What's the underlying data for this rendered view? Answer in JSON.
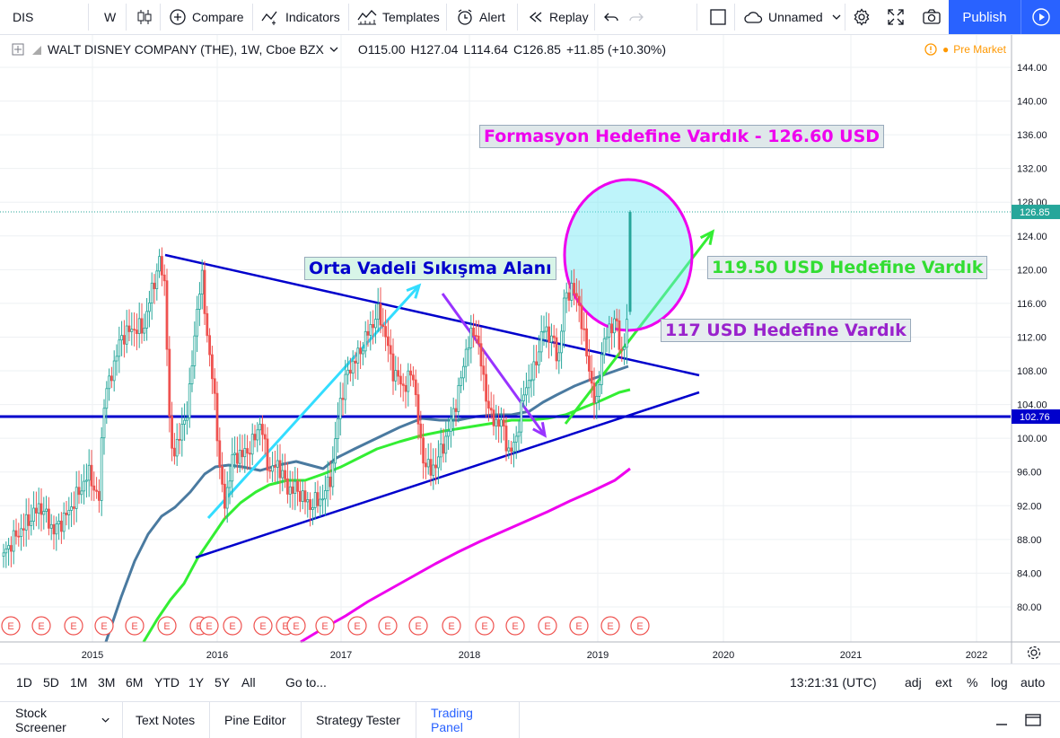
{
  "toolbar": {
    "symbol": "DIS",
    "interval": "W",
    "compare": "Compare",
    "indicators": "Indicators",
    "templates": "Templates",
    "alert": "Alert",
    "replay": "Replay",
    "layout_name": "Unnamed",
    "publish": "Publish"
  },
  "legend": {
    "title": "WALT DISNEY COMPANY (THE), 1W, Cboe BZX",
    "open": "O115.00",
    "high": "H127.04",
    "low": "L114.64",
    "close": "C126.85",
    "change": "+11.85 (+10.30%)",
    "premarket": "Pre Market"
  },
  "price_axis": {
    "ticks": [
      "144.00",
      "140.00",
      "136.00",
      "132.00",
      "128.00",
      "124.00",
      "120.00",
      "116.00",
      "112.00",
      "108.00",
      "104.00",
      "100.00",
      "96.00",
      "92.00",
      "88.00",
      "84.00",
      "80.00"
    ],
    "last_price_label": "126.85",
    "hline_label": "102.76"
  },
  "time_axis": {
    "ticks": [
      "2015",
      "2016",
      "2017",
      "2018",
      "2019",
      "2020",
      "2021",
      "2022"
    ]
  },
  "annotations": {
    "target1": "Formasyon Hedefine Vardık - 126.60 USD",
    "compression": "Orta Vadeli Sıkışma Alanı",
    "target2": "119.50 USD Hedefine Vardık",
    "target3": "117 USD Hedefine Vardık"
  },
  "earnings_marker": "E",
  "ranges": {
    "items": [
      "1D",
      "5D",
      "1M",
      "3M",
      "6M",
      "YTD",
      "1Y",
      "5Y",
      "All"
    ],
    "goto": "Go to...",
    "time": "13:21:31 (UTC)",
    "adj": "adj",
    "ext": "ext",
    "pct": "%",
    "log": "log",
    "auto": "auto"
  },
  "panel_tabs": [
    "Stock Screener",
    "Text Notes",
    "Pine Editor",
    "Strategy Tester",
    "Trading Panel"
  ],
  "colors": {
    "accent": "#2962ff",
    "up": "#26a69a",
    "down": "#ef5350",
    "trend_blue": "#0000cc",
    "cyan_arrow": "#33ddff",
    "purple_arrow": "#9933ff",
    "green_arrow": "#33ee33",
    "magenta": "#ee00ee",
    "ma_steel": "#4a7aa0"
  }
}
